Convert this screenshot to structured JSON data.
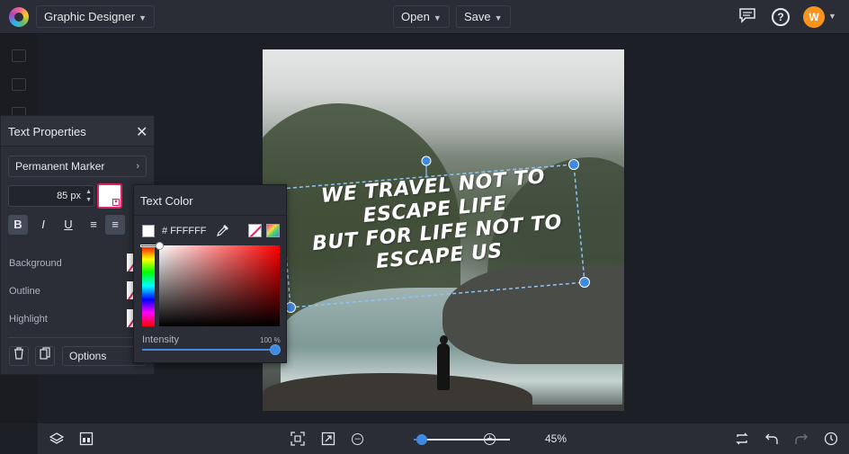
{
  "app": {
    "name": "Graphic Designer"
  },
  "header": {
    "open_label": "Open",
    "save_label": "Save",
    "user_initial": "W"
  },
  "text_properties": {
    "title": "Text Properties",
    "font": "Permanent Marker",
    "size_value": "85",
    "size_unit": "px",
    "rows": [
      "Background",
      "Outline",
      "Highlight"
    ],
    "options_label": "Options"
  },
  "text_color": {
    "title": "Text Color",
    "hex_prefix": "#",
    "hex_value": "FFFFFF",
    "intensity_label": "Intensity",
    "intensity_value": "100 %",
    "intensity_fraction": 1.0
  },
  "canvas": {
    "quote_lines": [
      "We travel not to",
      "escape life",
      "But for life not to",
      "escape us"
    ]
  },
  "zoom": {
    "percent": "45%",
    "fraction": 0.08
  }
}
